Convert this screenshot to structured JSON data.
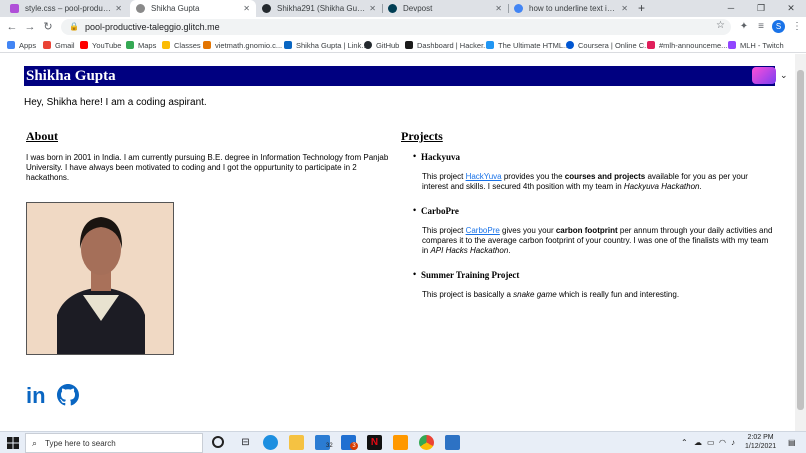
{
  "browser": {
    "tabs": [
      {
        "label": "style.css – pool-productive-taleg",
        "color": "#b04fd8",
        "active": false
      },
      {
        "label": "Shikha Gupta",
        "color": "#8a8a8a",
        "active": true
      },
      {
        "label": "Shikha291 (Shikha Gupta)",
        "color": "#24292e",
        "active": false
      },
      {
        "label": "Devpost",
        "color": "#003e54",
        "active": false
      },
      {
        "label": "how to underline text in css - Go",
        "color": "#4285f4",
        "active": false
      }
    ],
    "new_tab": "+",
    "url": "pool-productive-taleggio.glitch.me",
    "profile_initial": "S",
    "bookmarks": [
      {
        "label": "Apps",
        "color": "#4285f4"
      },
      {
        "label": "Gmail",
        "color": "#ea4335"
      },
      {
        "label": "YouTube",
        "color": "#ff0000"
      },
      {
        "label": "Maps",
        "color": "#34a853"
      },
      {
        "label": "Classes",
        "color": "#fbbc05"
      },
      {
        "label": "vietmath.gnomio.c...",
        "color": "#e37400"
      },
      {
        "label": "Shikha Gupta | Link...",
        "color": "#0a66c2"
      },
      {
        "label": "GitHub",
        "color": "#24292e"
      },
      {
        "label": "Dashboard | Hacker...",
        "color": "#1b1b1b"
      },
      {
        "label": "The Ultimate HTML...",
        "color": "#2196f3"
      },
      {
        "label": "Coursera | Online C...",
        "color": "#0056d2"
      },
      {
        "label": "#mlh-announceme...",
        "color": "#e01e5a"
      },
      {
        "label": "MLH - Twitch",
        "color": "#9146ff"
      }
    ]
  },
  "site": {
    "title": "Shikha Gupta",
    "intro": "Hey, Shikha here! I am a coding aspirant.",
    "about": {
      "heading": "About",
      "text": "I was born in 2001 in India. I am currently pursuing B.E. degree in Information Technology from Panjab University. I have always been motivated to coding and I got the oppurtunity to participate in 2 hackathons."
    },
    "projects": {
      "heading": "Projects",
      "items": [
        {
          "name": "Hackyuva",
          "pre": "This project ",
          "link": "HackYuva",
          "mid": " provides you the ",
          "bold": "courses and projects",
          "post": " available for you as per your interest and skills. I secured 4th position with my team in ",
          "italic": "Hackyuva Hackathon",
          "end": "."
        },
        {
          "name": "CarboPre",
          "pre": "This project ",
          "link": "CarboPre",
          "mid": " gives you your ",
          "bold": "carbon footprint",
          "post": " per annum through your daily activities and compares it to the average carbon footprint of your country. I was one of the finalists with my team in ",
          "italic": "API Hacks Hackathon",
          "end": "."
        },
        {
          "name": "Summer Training Project",
          "pre": "This project is basically a ",
          "link": "",
          "mid": "",
          "bold": "",
          "post": "",
          "italic": "snake game",
          "end": " which is really fun and interesting."
        }
      ]
    },
    "social": {
      "linkedin": "in"
    }
  },
  "taskbar": {
    "search_placeholder": "Type here to search",
    "time": "2:02 PM",
    "date": "1/12/2021",
    "mail_badge": "32",
    "app_badge": "3"
  }
}
